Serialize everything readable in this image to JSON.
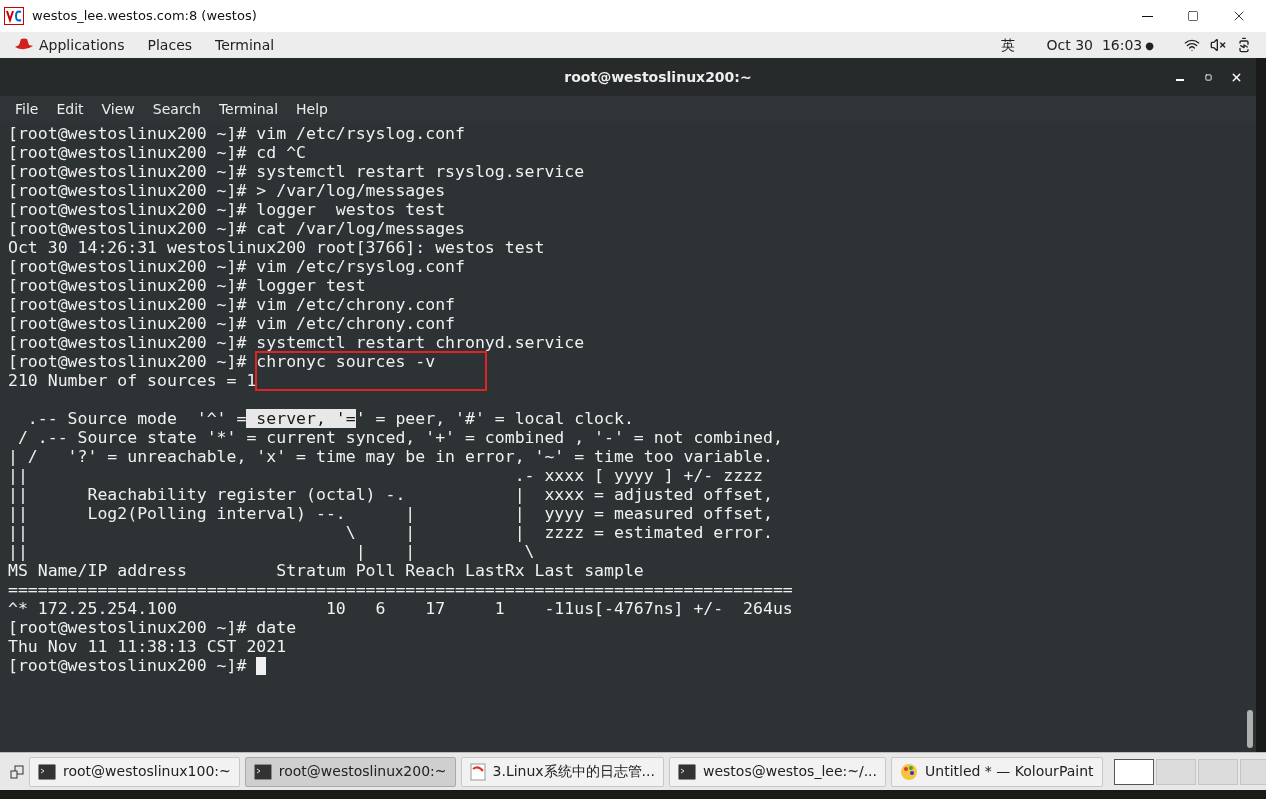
{
  "vnc_window": {
    "title": "westos_lee.westos.com:8 (westos)"
  },
  "top_bar": {
    "menus": [
      "Applications",
      "Places",
      "Terminal"
    ],
    "input_method": "英",
    "clock": "Oct 30  16:03",
    "clock_dot": "●"
  },
  "terminal": {
    "title": "root@westoslinux200:~",
    "menu": [
      "File",
      "Edit",
      "View",
      "Search",
      "Terminal",
      "Help"
    ],
    "markup_rectangle": true,
    "lines": [
      {
        "kind": "text",
        "segments": [
          {
            "text": "[root@westoslinux200 ~]# vim /etc/rsyslog.conf",
            "selected": false
          }
        ]
      },
      {
        "kind": "text",
        "segments": [
          {
            "text": "[root@westoslinux200 ~]# cd ^C",
            "selected": false
          }
        ]
      },
      {
        "kind": "text",
        "segments": [
          {
            "text": "[root@westoslinux200 ~]# systemctl restart rsyslog.service",
            "selected": false
          }
        ]
      },
      {
        "kind": "text",
        "segments": [
          {
            "text": "[root@westoslinux200 ~]# > /var/log/messages",
            "selected": false
          }
        ]
      },
      {
        "kind": "text",
        "segments": [
          {
            "text": "[root@westoslinux200 ~]# logger  westos test",
            "selected": false
          }
        ]
      },
      {
        "kind": "text",
        "segments": [
          {
            "text": "[root@westoslinux200 ~]# cat /var/log/messages",
            "selected": false
          }
        ]
      },
      {
        "kind": "text",
        "segments": [
          {
            "text": "Oct 30 14:26:31 westoslinux200 root[3766]: westos test",
            "selected": false
          }
        ]
      },
      {
        "kind": "text",
        "segments": [
          {
            "text": "[root@westoslinux200 ~]# vim /etc/rsyslog.conf",
            "selected": false
          }
        ]
      },
      {
        "kind": "text",
        "segments": [
          {
            "text": "[root@westoslinux200 ~]# logger test",
            "selected": false
          }
        ]
      },
      {
        "kind": "text",
        "segments": [
          {
            "text": "[root@westoslinux200 ~]# vim /etc/chrony.conf",
            "selected": false
          }
        ]
      },
      {
        "kind": "text",
        "segments": [
          {
            "text": "[root@westoslinux200 ~]# vim /etc/chrony.conf",
            "selected": false
          }
        ]
      },
      {
        "kind": "text",
        "segments": [
          {
            "text": "[root@westoslinux200 ~]# systemctl restart chronyd.service",
            "selected": false
          }
        ]
      },
      {
        "kind": "text",
        "segments": [
          {
            "text": "[root@westoslinux200 ~]# chronyc sources -v",
            "selected": false
          }
        ]
      },
      {
        "kind": "text",
        "segments": [
          {
            "text": "210 Number of sources = 1",
            "selected": false
          }
        ]
      },
      {
        "kind": "blank"
      },
      {
        "kind": "text",
        "segments": [
          {
            "text": "  .-- Source mode  '^' =",
            "selected": false
          },
          {
            "text": " server, '=",
            "selected": true
          },
          {
            "text": "' = peer, '#' = local clock.",
            "selected": false
          }
        ]
      },
      {
        "kind": "text",
        "segments": [
          {
            "text": " / .-- Source state '*' = current synced, '+' = combined , '-' = not combined,",
            "selected": false
          }
        ]
      },
      {
        "kind": "text",
        "segments": [
          {
            "text": "| /   '?' = unreachable, 'x' = time may be in error, '~' = time too variable.",
            "selected": false
          }
        ]
      },
      {
        "kind": "text",
        "segments": [
          {
            "text": "||                                                 .- xxxx [ yyyy ] +/- zzzz",
            "selected": false
          }
        ]
      },
      {
        "kind": "text",
        "segments": [
          {
            "text": "||      Reachability register (octal) -.           |  xxxx = adjusted offset,",
            "selected": false
          }
        ]
      },
      {
        "kind": "text",
        "segments": [
          {
            "text": "||      Log2(Polling interval) --.      |          |  yyyy = measured offset,",
            "selected": false
          }
        ]
      },
      {
        "kind": "text",
        "segments": [
          {
            "text": "||                                \\     |          |  zzzz = estimated error.",
            "selected": false
          }
        ]
      },
      {
        "kind": "text",
        "segments": [
          {
            "text": "||                                 |    |           \\",
            "selected": false
          }
        ]
      },
      {
        "kind": "text",
        "segments": [
          {
            "text": "MS Name/IP address         Stratum Poll Reach LastRx Last sample",
            "selected": false
          }
        ]
      },
      {
        "kind": "text",
        "segments": [
          {
            "text": "===============================================================================",
            "selected": false
          }
        ]
      },
      {
        "kind": "text",
        "segments": [
          {
            "text": "^* 172.25.254.100               10   6    17     1    -11us[-4767ns] +/-  264us",
            "selected": false
          }
        ]
      },
      {
        "kind": "text",
        "segments": [
          {
            "text": "[root@westoslinux200 ~]# date",
            "selected": false
          }
        ]
      },
      {
        "kind": "text",
        "segments": [
          {
            "text": "Thu Nov 11 11:38:13 CST 2021",
            "selected": false
          }
        ]
      },
      {
        "kind": "prompt",
        "segments": [
          {
            "text": "[root@westoslinux200 ~]# ",
            "selected": false
          }
        ],
        "cursor": true
      }
    ]
  },
  "taskbar": {
    "tasks": [
      {
        "label": "root@westoslinux100:~",
        "kind": "terminal",
        "selected": false
      },
      {
        "label": "root@westoslinux200:~",
        "kind": "terminal",
        "selected": true
      },
      {
        "label": "3.Linux系统中的日志管...",
        "kind": "document",
        "selected": false
      },
      {
        "label": "westos@westos_lee:~/...",
        "kind": "terminal",
        "selected": false
      },
      {
        "label": "Untitled * — KolourPaint",
        "kind": "paint",
        "selected": false
      }
    ],
    "workspaces": [
      {
        "selected": true
      },
      {
        "selected": false
      },
      {
        "selected": false
      },
      {
        "selected": false
      }
    ]
  }
}
